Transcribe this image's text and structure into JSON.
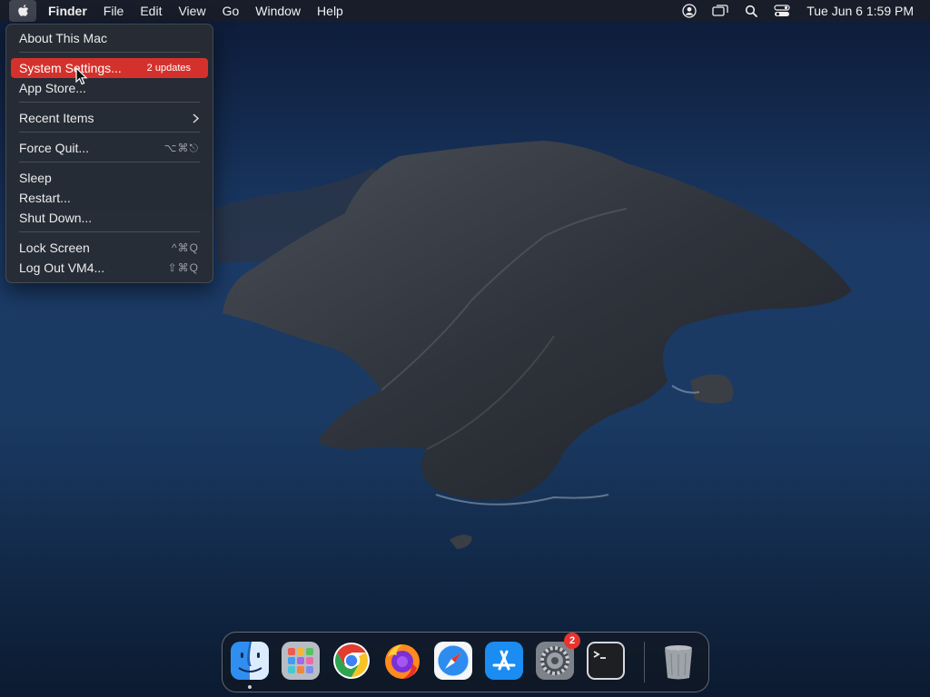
{
  "menubar": {
    "app_name": "Finder",
    "menus": [
      "File",
      "Edit",
      "View",
      "Go",
      "Window",
      "Help"
    ],
    "clock": "Tue Jun 6  1:59 PM",
    "status_icons": [
      "user-icon",
      "screen-mirroring-icon",
      "spotlight-search-icon",
      "control-center-icon"
    ]
  },
  "apple_menu": {
    "items": [
      {
        "label": "About This Mac"
      },
      {
        "label": "System Settings...",
        "badge": "2 updates",
        "highlighted": true
      },
      {
        "label": "App Store..."
      },
      {
        "label": "Recent Items",
        "submenu": true
      },
      {
        "label": "Force Quit...",
        "shortcut": "⌥⌘⎋"
      },
      {
        "label": "Sleep"
      },
      {
        "label": "Restart..."
      },
      {
        "label": "Shut Down..."
      },
      {
        "label": "Lock Screen",
        "shortcut": "^⌘Q"
      },
      {
        "label": "Log Out VM4...",
        "shortcut": "⇧⌘Q"
      }
    ],
    "highlight_color": "#d5312c"
  },
  "dock": {
    "apps": [
      "Finder",
      "Launchpad",
      "Google Chrome",
      "Firefox",
      "Safari",
      "App Store",
      "System Settings",
      "Terminal",
      "Trash"
    ],
    "running": [
      "Finder"
    ],
    "badges": {
      "System Settings": "2"
    }
  }
}
